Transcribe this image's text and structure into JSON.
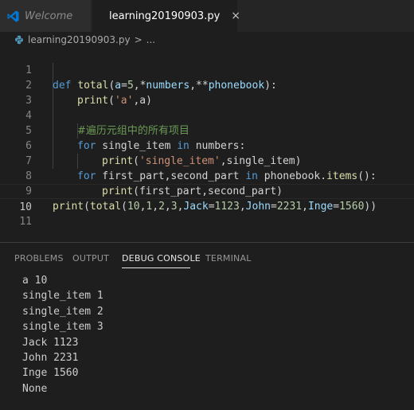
{
  "tabs": {
    "welcome": "Welcome",
    "file": "learning20190903.py",
    "close_glyph": "×"
  },
  "breadcrumb": {
    "file": "learning20190903.py",
    "separator": ">",
    "more": "..."
  },
  "editor": {
    "line_numbers": [
      "1",
      "2",
      "3",
      "4",
      "5",
      "6",
      "7",
      "8",
      "9",
      "10",
      "11"
    ],
    "current_line": "10",
    "l1": {
      "def": "def",
      "fn": "total",
      "open": "(",
      "a": "a",
      "eq": "=",
      "five": "5",
      "comma1": ",*",
      "numbers": "numbers",
      "comma2": ",**",
      "phonebook": "phonebook",
      "close": "):"
    },
    "l2": {
      "fn": "print",
      "open": "(",
      "str": "'a'",
      "rest": ",a)"
    },
    "l4": {
      "comment": "#遍历元组中的所有项目"
    },
    "l5": {
      "for": "for",
      "var": " single_item ",
      "in": "in",
      "rest": " numbers:"
    },
    "l6": {
      "fn": "print",
      "open": "(",
      "str": "'single_item'",
      "rest": ",single_item)"
    },
    "l7": {
      "for": "for",
      "vars": " first_part,second_part ",
      "in": "in",
      "obj": " phonebook.",
      "method": "items",
      "rest": "():"
    },
    "l8": {
      "fn": "print",
      "rest": "(first_part,second_part)"
    },
    "l9": {
      "fn1": "print",
      "open1": "(",
      "fn2": "total",
      "args": "(",
      "n10": "10",
      "c1": ",",
      "n1": "1",
      "c2": ",",
      "n2": "2",
      "c3": ",",
      "n3": "3",
      "c4": ",",
      "jack": "Jack",
      "eq1": "=",
      "v1": "1123",
      "c5": ",",
      "john": "John",
      "eq2": "=",
      "v2": "2231",
      "c6": ",",
      "inge": "Inge",
      "eq3": "=",
      "v3": "1560",
      "close": "))"
    }
  },
  "panel": {
    "tabs": [
      "PROBLEMS",
      "OUTPUT",
      "DEBUG CONSOLE",
      "TERMINAL"
    ],
    "active_tab": "DEBUG CONSOLE",
    "console_lines": [
      "a 10",
      "single_item 1",
      "single_item 2",
      "single_item 3",
      "Jack 1123",
      "John 2231",
      "Inge 1560",
      "None"
    ]
  },
  "colors": {
    "background": "#1e1e1e",
    "tabbar": "#252526",
    "keyword": "#569cd6",
    "function": "#dcdcaa",
    "parameter": "#9cdcfe",
    "number": "#b5cea8",
    "string": "#ce9178",
    "comment": "#6a9955",
    "vscode_icon": "#0078d4",
    "python_icon": "#519aba"
  },
  "icons": {
    "welcome_tab": "vscode-logo-icon",
    "file_tab": "python-file-icon",
    "breadcrumb": "python-file-icon"
  }
}
